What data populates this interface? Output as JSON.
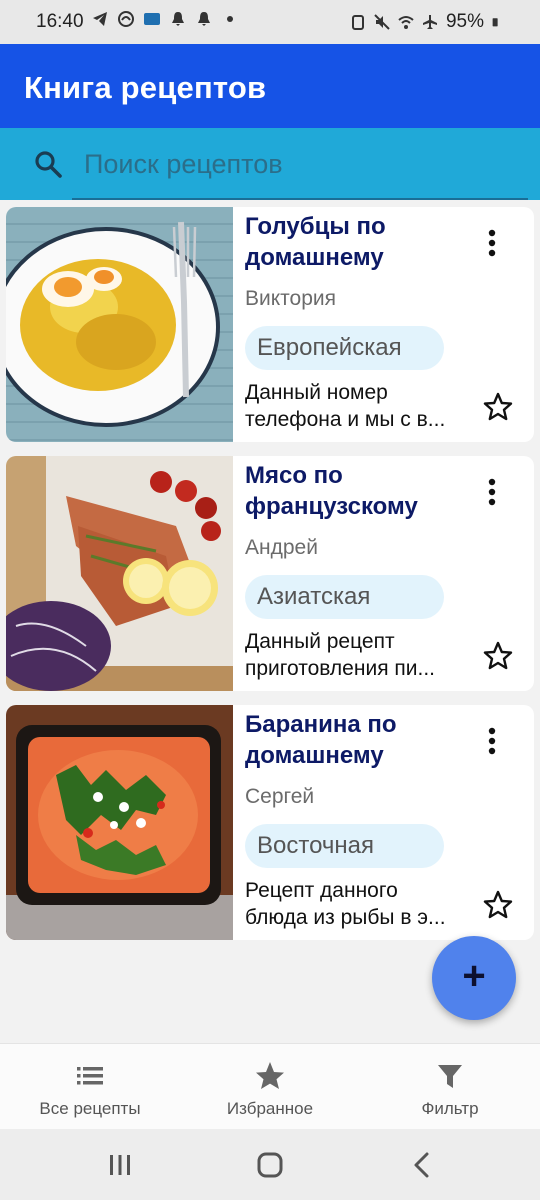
{
  "status_bar": {
    "time": "16:40",
    "battery": "95%"
  },
  "app_bar": {
    "title": "Книга рецептов"
  },
  "search": {
    "placeholder": "Поиск рецептов"
  },
  "recipes": [
    {
      "title": "Голубцы по домашнему",
      "author": "Виктория",
      "cuisine": "Европейская",
      "desc_line1": "Данный номер",
      "desc_line2": "телефона и мы с в..."
    },
    {
      "title": "Мясо по французскому",
      "author": "Андрей",
      "cuisine": "Азиатская",
      "desc_line1": "Данный рецепт",
      "desc_line2": "приготовления пи..."
    },
    {
      "title": "Баранина по домашнему",
      "author": "Сергей",
      "cuisine": "Восточная",
      "desc_line1": "Рецепт данного",
      "desc_line2": "блюда из рыбы в э..."
    }
  ],
  "fab": {
    "label": "+"
  },
  "bottom_nav": [
    {
      "label": "Все рецепты",
      "icon": "list-icon"
    },
    {
      "label": "Избранное",
      "icon": "star-icon"
    },
    {
      "label": "Фильтр",
      "icon": "filter-icon"
    }
  ],
  "colors": {
    "app_bar": "#1653e6",
    "search_bar": "#20a9d8",
    "title_text": "#0d1a66",
    "chip_bg": "#e2f3fc",
    "fab": "#5082ec"
  }
}
